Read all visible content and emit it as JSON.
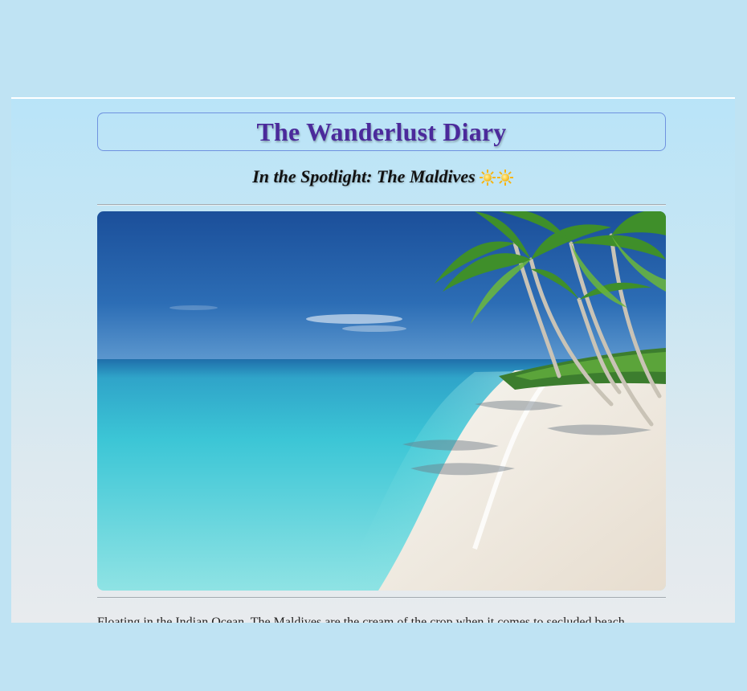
{
  "header": {
    "title": "The Wanderlust Diary"
  },
  "spotlight": {
    "heading": "In the Spotlight: The Maldives",
    "decor_icons": [
      "sun-icon",
      "sun-icon"
    ]
  },
  "hero_image": {
    "subject": "tropical-beach-photo"
  },
  "article": {
    "intro_text": "Floating in the Indian Ocean, The Maldives are the cream of the crop when it comes to secluded beach"
  },
  "colors": {
    "title": "#4b2a9b",
    "title_border": "#6f92df",
    "page_background": "#bfe3f3"
  }
}
